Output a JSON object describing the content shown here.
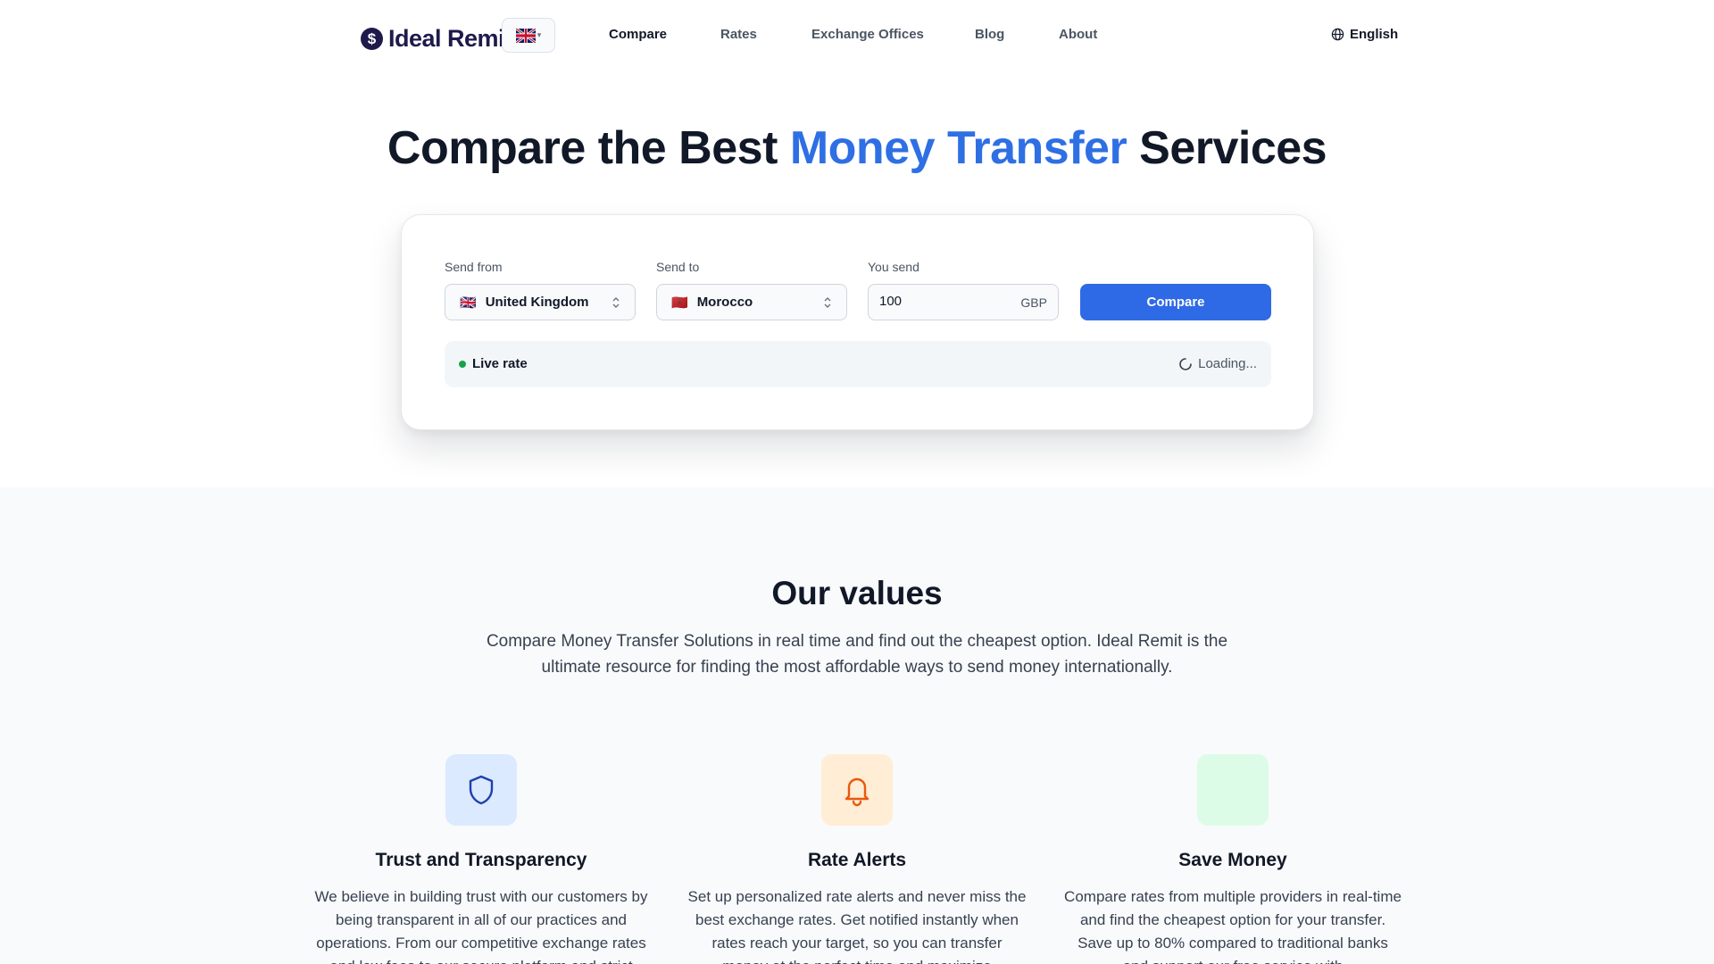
{
  "brand": {
    "name": "Ideal Remit",
    "logo_symbol": "$"
  },
  "header": {
    "nav": [
      {
        "label": "Compare",
        "active": true
      },
      {
        "label": "Rates",
        "active": false
      },
      {
        "label": "Exchange Offices",
        "active": false
      },
      {
        "label": "Blog",
        "active": false
      },
      {
        "label": "About",
        "active": false
      }
    ],
    "language": {
      "label": "English",
      "icon": "globe-icon"
    },
    "flag_selector": {
      "icon": "uk-flag-icon"
    }
  },
  "hero": {
    "title_before": "Compare the Best ",
    "title_highlight": "Money Transfer",
    "title_after": " Services",
    "highlight_color": "#2f6fe4"
  },
  "form": {
    "send_from": {
      "label": "Send from",
      "value": "United Kingdom",
      "flag": "🇬🇧"
    },
    "send_to": {
      "label": "Send to",
      "value": "Morocco",
      "flag": "🇲🇦"
    },
    "you_send": {
      "label": "You send",
      "value": "100",
      "currency": "GBP"
    },
    "compare_button": "Compare",
    "live_rate_label": "Live rate",
    "loading_text": "Loading...",
    "accent_color": "#2f6ae6",
    "live_color": "#16a34a"
  },
  "values": {
    "title": "Our values",
    "description": "Compare Money Transfer Solutions in real time and find out the cheapest option. Ideal Remit is the ultimate resource for finding the most affordable ways to send money internationally.",
    "features": [
      {
        "icon": "shield-icon",
        "title": "Trust and Transparency",
        "description": "We believe in building trust with our customers by being transparent in all of our practices and operations. From our competitive exchange rates and low fees to our secure platform and strict"
      },
      {
        "icon": "bell-icon",
        "title": "Rate Alerts",
        "description": "Set up personalized rate alerts and never miss the best exchange rates. Get notified instantly when rates reach your target, so you can transfer money at the perfect time and maximize"
      },
      {
        "icon": "savings-icon",
        "title": "Save Money",
        "description": "Compare rates from multiple providers in real-time and find the cheapest option for your transfer. Save up to 80% compared to traditional banks and support our free service with"
      }
    ]
  }
}
